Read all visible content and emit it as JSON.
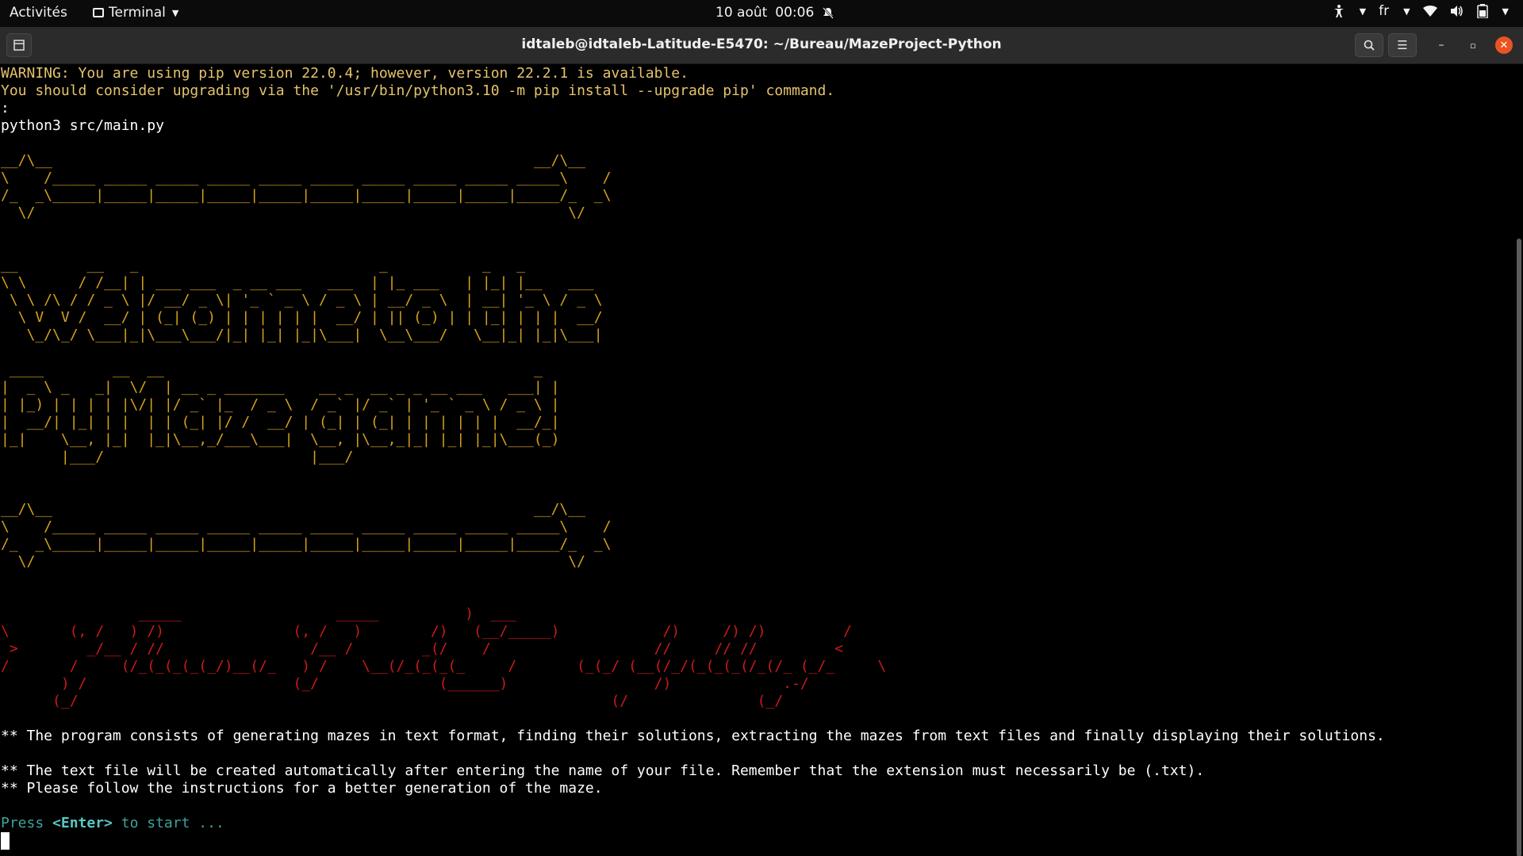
{
  "topbar": {
    "activities": "Activités",
    "app_name": "Terminal",
    "date": "10 août",
    "time": "00:06",
    "language": "fr"
  },
  "titlebar": {
    "title": "idtaleb@idtaleb-Latitude-E5470: ~/Bureau/MazeProject-Python"
  },
  "terminal": {
    "warning_lines": [
      "WARNING: You are using pip version 22.0.4; however, version 22.2.1 is available.",
      "You should consider upgrading via the '/usr/bin/python3.10 -m pip install --upgrade pip' command."
    ],
    "colon_line": ":",
    "command": "python3 src/main.py",
    "banner_top": "__/\\__                                                        __/\\__\n\\    /_____ _____ _____ _____ _____ _____ _____ _____ _____ _____\\    /\n/_  _\\_____|_____|_____|_____|_____|_____|_____|_____|_____|_____/_  _\\\n  \\/                                                              \\/",
    "welcome_art": "__        __   _                            _           _   _\n\\ \\      / /__| | ___ ___  _ __ ___   ___  | |_ ___   | |_| |__   ___\n \\ \\ /\\ / / _ \\ |/ __/ _ \\| '_ ` _ \\ / _ \\ | __/ _ \\  | __| '_ \\ / _ \\\n  \\ V  V /  __/ | (_| (_) | | | | | |  __/ | || (_) | | |_| | | |  __/\n   \\_/\\_/ \\___|_|\\___\\___/|_| |_| |_|\\___|  \\__\\___/   \\__|_| |_|\\___|",
    "pymaze_art": " ____        __  __                                           _\n|  _ \\ _   _|  \\/  | __ _ _______    __ _  __ _ _ __ ___   ___| |\n| |_) | | | | |\\/| |/ _` |_  / _ \\  / _` |/ _` | '_ ` _ \\ / _ \\ |\n|  __/| |_| | |  | | (_| |/ /  __/ | (_| | (_| | | | | | |  __/_|\n|_|    \\__, |_|  |_|\\__,_/___\\___|  \\__, |\\__,_|_| |_| |_|\\___(_)\n       |___/                        |___/",
    "banner_bottom": "__/\\__                                                        __/\\__\n\\    /_____ _____ _____ _____ _____ _____ _____ _____ _____ _____\\    /\n/_  _\\_____|_____|_____|_____|_____|_____|_____|_____|_____|_____/_  _\\\n  \\/                                                              \\/",
    "author_art": "                _____                  _____          )  ___                                           \n\\       (, /   ) /)               (, /   )        /)   (__/_____)            /)     /) /)         /\n >        _/__ / //                 /__ /        _(/    /                   //     // //         <\n/       /     (/_(_(_(_(_/)__(/_   ) /    \\__(/_(_(_(_     /       (_(_/ (__(/_/(_(_(_(/_(/_ (_/_     \\\n       ) /                        (_/              (______)                 /)             .-/\n      (_/                                                              (/               (_/",
    "info_line_1": "** The program consists of generating mazes in text format, finding their solutions, extracting the mazes from text files and finally displaying their solutions.",
    "info_line_2": "** The text file will be created automatically after entering the name of your file. Remember that the extension must necessarily be (.txt).",
    "info_line_3": "** Please follow the instructions for a better generation of the maze.",
    "prompt_before": "Press ",
    "prompt_key": "<Enter>",
    "prompt_after": " to start ..."
  },
  "colors": {
    "warning": "#e5c36b",
    "banner": "#d6a11c",
    "author": "#cc1a1a",
    "prompt": "#3aa4a0",
    "close_button": "#e95420"
  },
  "icons": {
    "accessibility": "accessibility-icon",
    "wifi": "wifi-icon",
    "volume": "volume-icon",
    "battery": "battery-icon",
    "notifications_off": "bell-off-icon"
  }
}
